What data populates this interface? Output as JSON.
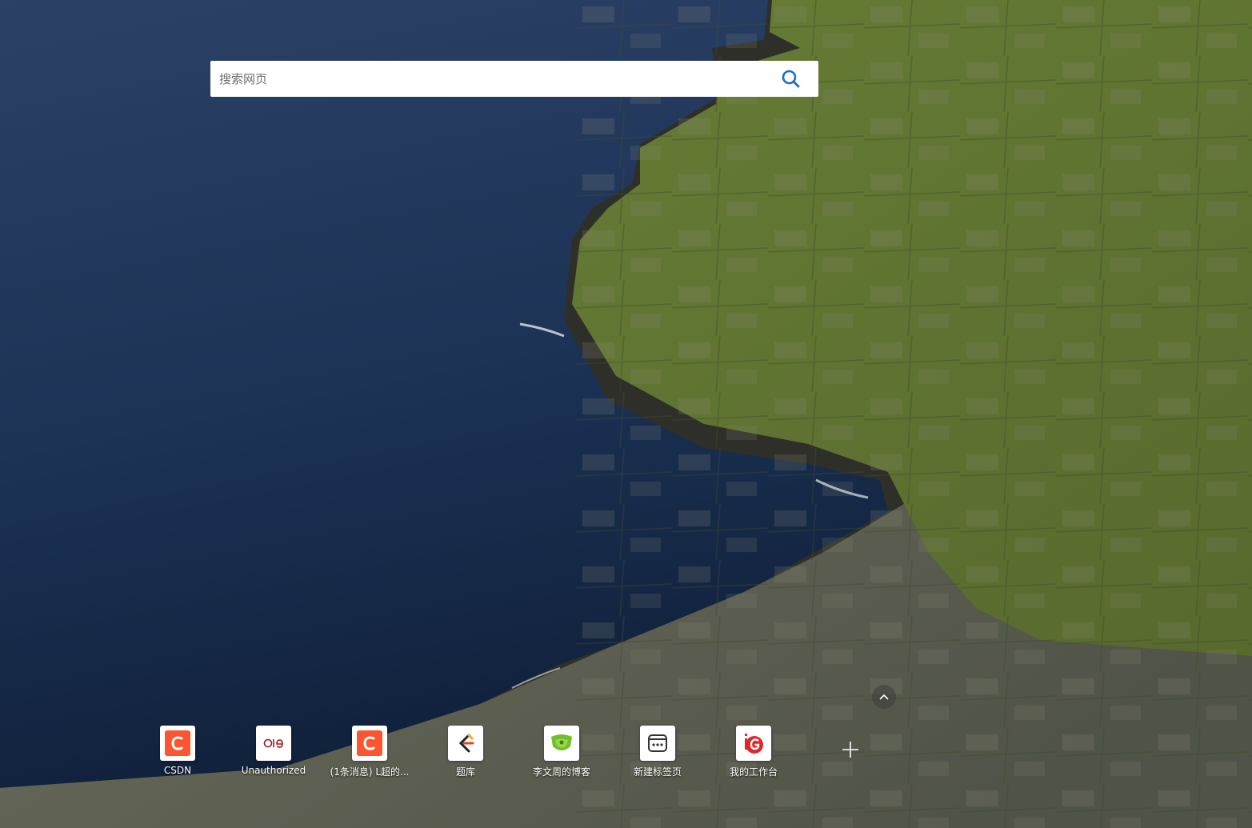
{
  "search": {
    "placeholder": "搜索网页",
    "value": ""
  },
  "shortcuts": [
    {
      "label": "CSDN",
      "icon": "csdn-icon"
    },
    {
      "label": "Unauthorized",
      "icon": "oie-icon"
    },
    {
      "label": "(1条消息) L超的...",
      "icon": "csdn-icon"
    },
    {
      "label": "题库",
      "icon": "tiku-icon"
    },
    {
      "label": "李文周的博客",
      "icon": "blog-icon"
    },
    {
      "label": "新建标签页",
      "icon": "new-tab-icon"
    },
    {
      "label": "我的工作台",
      "icon": "workbench-icon"
    }
  ],
  "colors": {
    "search_icon": "#1a6fc4",
    "csdn_red": "#fc5531",
    "sea": "#1d3558",
    "land_green": "#5e7a2c",
    "rock": "#5d5d55"
  }
}
